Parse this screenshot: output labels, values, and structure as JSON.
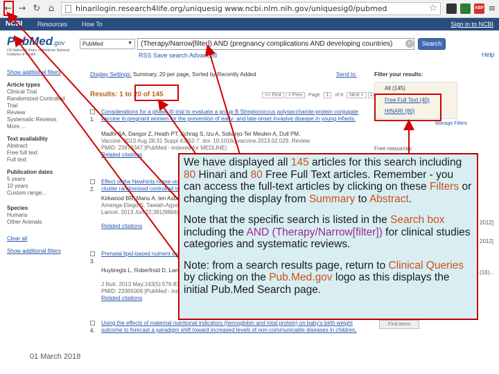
{
  "browser": {
    "url": "hinarilogin.research4life.org/uniquesig www.ncbi.nlm.nih.gov/uniquesig0/pubmed",
    "extensions": [
      "ABP",
      "A",
      "B"
    ]
  },
  "ncbi_header": {
    "logo": "NCBI",
    "menu": [
      "Resources",
      "How To"
    ],
    "sign_in": "Sign in to NCBI"
  },
  "pubmed": {
    "logo_main": "PubMed",
    "logo_suffix": ".gov",
    "subtitle": "US National Library of Medicine National Institutes of Health",
    "database": "PubMed",
    "query": "(Therapy/Narrow[filter]) AND (pregnancy complications AND developing countries)",
    "search_button": "Search",
    "rss_link": "RSS  Save search  Advanced",
    "help": "Help"
  },
  "sidebar": {
    "show_filters_top": "Show additional filters",
    "article_types_head": "Article types",
    "article_types": [
      "Clinical Trial",
      "Randomized Controlled Trial",
      "Review",
      "Systematic Reviews",
      "More ..."
    ],
    "text_avail_head": "Text availability",
    "text_avail": [
      "Abstract",
      "Free full text",
      "Full text"
    ],
    "pub_dates_head": "Publication dates",
    "pub_dates": [
      "5 years",
      "10 years",
      "Custom range..."
    ],
    "species_head": "Species",
    "species": [
      "Humans",
      "Other Animals"
    ],
    "clear_all": "Clear all",
    "show_filters_bottom": "Show additional filters"
  },
  "results_header": {
    "display_label": "Display Settings:",
    "display_value": "Summary, 20 per page, Sorted by Recently Added",
    "send_to": "Send to:",
    "results_text": "Results: 1 to 20 of 145",
    "pager": [
      "<< First",
      "< Prev",
      "Page",
      "1",
      "of 8",
      "Next >",
      "Last >>"
    ]
  },
  "results": [
    {
      "num": "1.",
      "title": "Considerations for a phase-III trial to evaluate a group B Streptococcus polysaccharide-protein conjugate vaccine in pregnant women for the prevention of early- and late-onset invasive disease in young infants.",
      "authors": "Madhi SA, Dangor Z, Heath PT, Schrag S, Izu A, Sobanjo-Ter Meulen A, Dull PM.",
      "journal": "Vaccine. 2013 Aug 28;31 Suppl 4:D52-7. doi: 10.1016/j.vaccine.2013.02.029. Review.",
      "pmid": "PMID: 23973347 [PubMed - indexed for MEDLINE]",
      "related": "Related citations"
    },
    {
      "num": "2.",
      "title": "Effect of the Newhints home-visits intervention on neonatal mortality rate and care practices in Ghana: a cluster randomised controlled trial.",
      "authors": "Kirkwood BR, Manu A, ten Asbroek AH, Soremekun S, Weobong B, Gyan T, Danso S,",
      "journal": "Amenga-Etego S, Tawiah-Agyemang C, Owusu-Agyei S, Hill Z.",
      "pmid": "Lancet. 2013 Jun 22;381(9884):2184-92. PMID: 23578528 [PubMed - indexed]",
      "related": "Related citations"
    },
    {
      "num": "3.",
      "title": "Prenatal lipid-based nutrient supplements and birth outcomes in women from rural Burkina Faso.",
      "authors": "Huybregts L, Roberfroid D, Lanou H, Menten J, Meda N, Van Camp J, Kolsteren P.",
      "journal": "J Nutr. 2013 May;143(5):576-83.",
      "pmid": "PMID: 23365009 [PubMed - indexed for MEDLINE]",
      "related": "Related citations"
    },
    {
      "num": "4.",
      "title": "Using the effects of maternal nutritional indicators (hemoglobin and total protein) on baby's birth weight outcome to forecast a paradigm shift toward increased levels of non-communicable diseases in children.",
      "authors": "",
      "journal": "",
      "pmid": "",
      "related": ""
    }
  ],
  "filter_panel": {
    "title": "Filter your results:",
    "all": "All (145)",
    "free_full_text": "Free Full Text (40)",
    "hinari": "HINARI (80)",
    "manage": "Manage Filters",
    "find_items": "Find items",
    "fragments": [
      "Free resources",
      "2012]",
      "2012]",
      "(16)..."
    ]
  },
  "callout": {
    "p1_a": "We have displayed all ",
    "p1_n1": "145",
    "p1_b": " articles for this search including ",
    "p1_n2": "80",
    "p1_c": " Hinari and ",
    "p1_n3": "80",
    "p1_d": " Free Full Text articles. Remember  -  you can access the full-text articles by clicking on these ",
    "p1_filters": "Filters",
    "p1_e": " or changing the display from ",
    "p1_summary": "Summary",
    "p1_f": " to ",
    "p1_abstract": "Abstract",
    "p1_g": ".",
    "p2_a": "Note that the specific search is listed in the ",
    "p2_search": "Search box",
    "p2_b": " including the ",
    "p2_and": "AND (Therapy/Narrow[filter])",
    "p2_c": " for clinical studies categories and systematic reviews.",
    "p3_a": "Note: from a search results page,  return to ",
    "p3_cq": "Clinical Queries",
    "p3_b": " by clicking on the ",
    "p3_logo": "Pub.Med.gov",
    "p3_c": " logo as this displays the initial Pub.Med Search page."
  },
  "footer": {
    "date": "01 March 2018"
  },
  "colors": {
    "highlight": "#c8511c",
    "callout_border": "#c00000",
    "callout_bg": "#d9eef2",
    "ncbi_blue": "#2a4d80"
  }
}
